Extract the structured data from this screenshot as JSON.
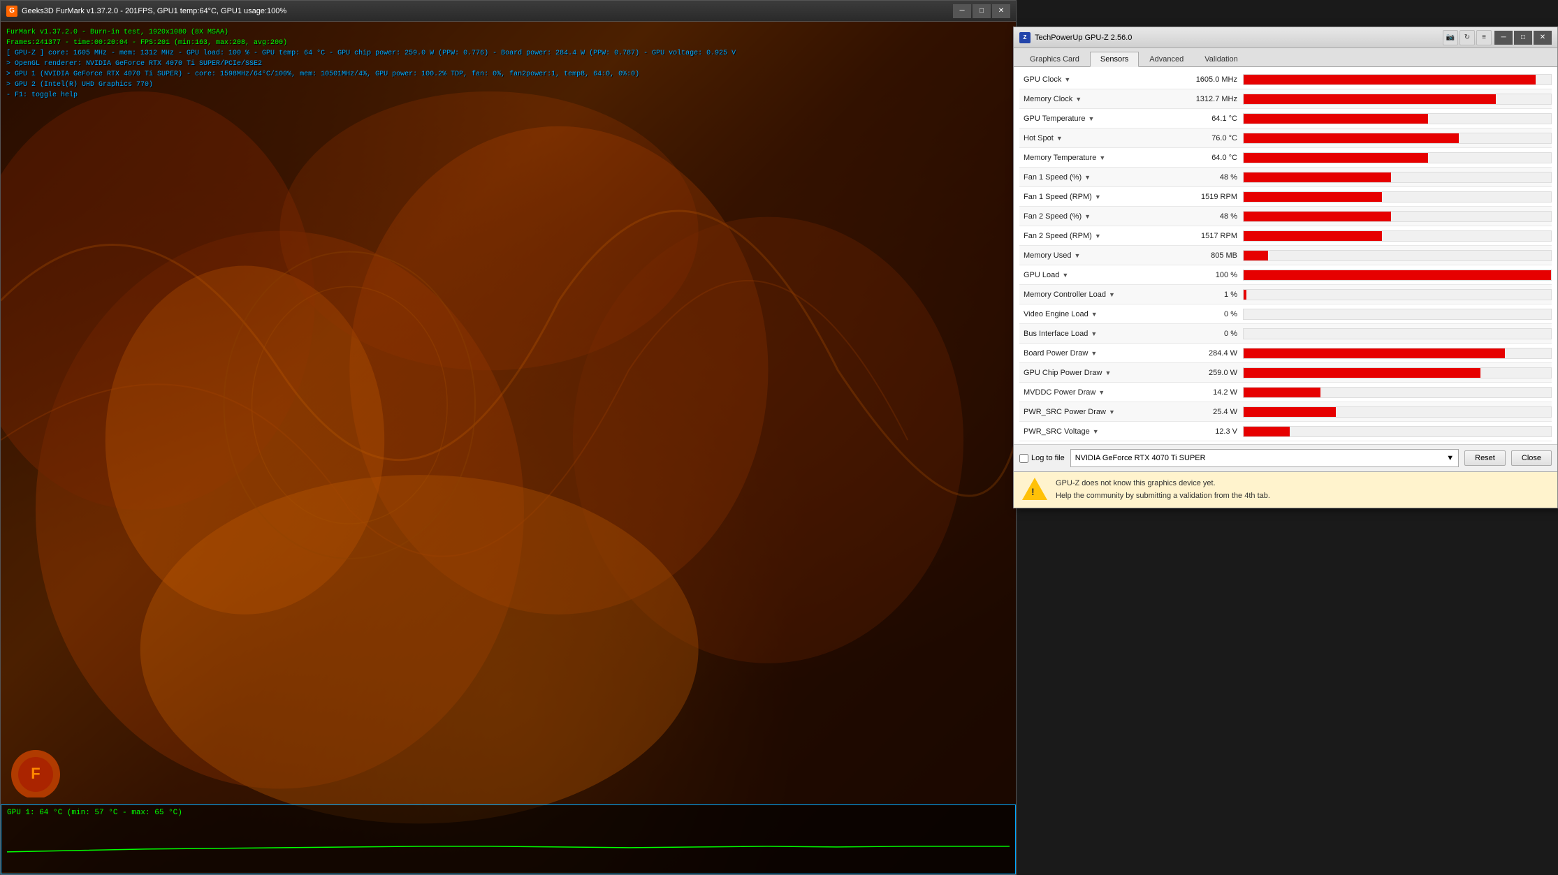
{
  "furmark": {
    "title": "Geeks3D FurMark v1.37.2.0 - 201FPS, GPU1 temp:64°C, GPU1 usage:100%",
    "overlay": {
      "line1": "FurMark v1.37.2.0 - Burn-in test, 1920x1080 (8X MSAA)",
      "line2": "Frames:241377 - time:00:20:04 - FPS:201 (min:163, max:208, avg:200)",
      "line3": "[ GPU-Z ] core: 1605 MHz - mem: 1312 MHz - GPU load: 100 % - GPU temp: 64 °C - GPU chip power: 259.0 W (PPW: 0.776) - Board power: 284.4 W (PPW: 0.787) - GPU voltage: 0.925 V",
      "line4": "> OpenGL renderer: NVIDIA GeForce RTX 4070 Ti SUPER/PCIe/SSE2",
      "line5": "> GPU 1 (NVIDIA GeForce RTX 4070 Ti SUPER) - core: 1598MHz/64°C/100%, mem: 10501MHz/4%, GPU power: 100.2% TDP, fan: 0%, fan2power:1, temp8, 64:0, 0%:0)",
      "line6": "> GPU 2 (Intel(R) UHD Graphics 770)",
      "line7": "- F1: toggle help",
      "line8": ""
    },
    "gpu_temp_label": "GPU 1: 64 °C (min: 57 °C - max: 65 °C)"
  },
  "gpuz": {
    "title": "TechPowerUp GPU-Z 2.56.0",
    "tabs": [
      "Graphics Card",
      "Sensors",
      "Advanced",
      "Validation"
    ],
    "active_tab": "Sensors",
    "toolbar_icons": [
      "camera",
      "refresh",
      "menu"
    ],
    "sensors": [
      {
        "name": "GPU Clock",
        "value": "1605.0 MHz",
        "bar_pct": 95
      },
      {
        "name": "Memory Clock",
        "value": "1312.7 MHz",
        "bar_pct": 82
      },
      {
        "name": "GPU Temperature",
        "value": "64.1 °C",
        "bar_pct": 60
      },
      {
        "name": "Hot Spot",
        "value": "76.0 °C",
        "bar_pct": 70
      },
      {
        "name": "Memory Temperature",
        "value": "64.0 °C",
        "bar_pct": 60
      },
      {
        "name": "Fan 1 Speed (%)",
        "value": "48 %",
        "bar_pct": 48
      },
      {
        "name": "Fan 1 Speed (RPM)",
        "value": "1519 RPM",
        "bar_pct": 45
      },
      {
        "name": "Fan 2 Speed (%)",
        "value": "48 %",
        "bar_pct": 48
      },
      {
        "name": "Fan 2 Speed (RPM)",
        "value": "1517 RPM",
        "bar_pct": 45
      },
      {
        "name": "Memory Used",
        "value": "805 MB",
        "bar_pct": 8
      },
      {
        "name": "GPU Load",
        "value": "100 %",
        "bar_pct": 100
      },
      {
        "name": "Memory Controller Load",
        "value": "1 %",
        "bar_pct": 1
      },
      {
        "name": "Video Engine Load",
        "value": "0 %",
        "bar_pct": 0
      },
      {
        "name": "Bus Interface Load",
        "value": "0 %",
        "bar_pct": 0
      },
      {
        "name": "Board Power Draw",
        "value": "284.4 W",
        "bar_pct": 85
      },
      {
        "name": "GPU Chip Power Draw",
        "value": "259.0 W",
        "bar_pct": 77
      },
      {
        "name": "MVDDC Power Draw",
        "value": "14.2 W",
        "bar_pct": 25
      },
      {
        "name": "PWR_SRC Power Draw",
        "value": "25.4 W",
        "bar_pct": 30
      },
      {
        "name": "PWR_SRC Voltage",
        "value": "12.3 V",
        "bar_pct": 15
      }
    ],
    "log_to_file_label": "Log to file",
    "selected_gpu": "NVIDIA GeForce RTX 4070 Ti SUPER",
    "reset_btn": "Reset",
    "close_btn": "Close",
    "warning_text_line1": "GPU-Z does not know this graphics device yet.",
    "warning_text_line2": "Help the community by submitting a validation from the 4th tab.",
    "win_controls": {
      "minimize": "─",
      "maximize": "□",
      "close": "✕"
    }
  }
}
